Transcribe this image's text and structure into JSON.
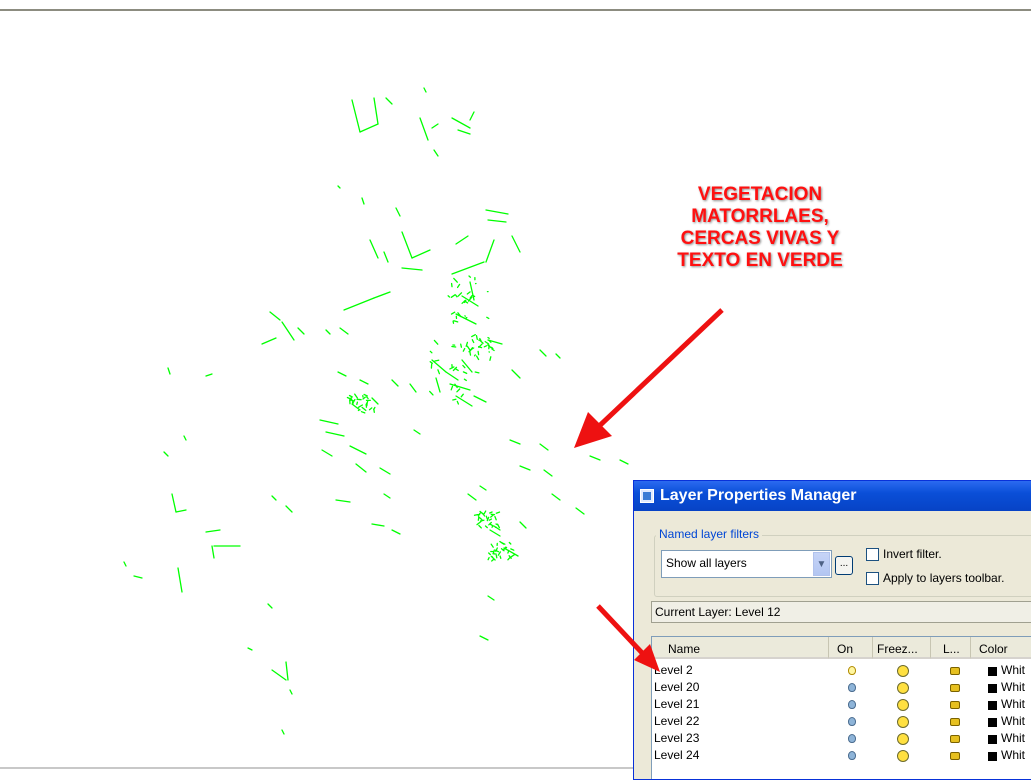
{
  "annotation": {
    "lines": [
      "VEGETACION",
      "MATORRLAES,",
      "CERCAS VIVAS Y",
      "TEXTO EN VERDE"
    ],
    "color": "#ff1010"
  },
  "drawing": {
    "stroke_color": "#00ff00"
  },
  "dialog": {
    "title": "Layer Properties Manager",
    "named_filters_legend": "Named layer filters",
    "filter_value": "Show all layers",
    "ellipsis": "...",
    "invert_filter": "Invert filter.",
    "apply_toolbar": "Apply to layers toolbar.",
    "current_layer_label": "Current Layer:",
    "current_layer_value": "Level 12",
    "columns": [
      "Name",
      "On",
      "Freez...",
      "L...",
      "Color"
    ],
    "rows": [
      {
        "name": "Level 2",
        "on": true,
        "color": "Whit"
      },
      {
        "name": "Level 20",
        "on": false,
        "color": "Whit"
      },
      {
        "name": "Level 21",
        "on": false,
        "color": "Whit"
      },
      {
        "name": "Level 22",
        "on": false,
        "color": "Whit"
      },
      {
        "name": "Level 23",
        "on": false,
        "color": "Whit"
      },
      {
        "name": "Level 24",
        "on": false,
        "color": "Whit"
      }
    ]
  }
}
